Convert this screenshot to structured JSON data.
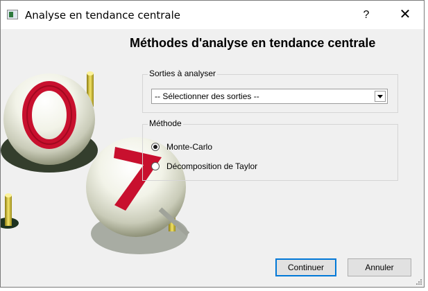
{
  "window": {
    "title": "Analyse en tendance centrale",
    "help_label": "?",
    "close_label": "✕"
  },
  "heading": "Méthodes d'analyse en tendance centrale",
  "outputs": {
    "group_label": "Sorties à analyser",
    "combo_value": "-- Sélectionner des sorties --"
  },
  "method": {
    "group_label": "Méthode",
    "options": [
      {
        "label": "Monte-Carlo",
        "checked": true
      },
      {
        "label": "Décomposition de Taylor",
        "checked": false
      }
    ]
  },
  "buttons": {
    "continue": "Continuer",
    "cancel": "Annuler"
  },
  "colors": {
    "accent": "#0078d7",
    "sphere_text": "#c8102e"
  },
  "icons": {
    "app": "app-window-icon",
    "help": "help-icon",
    "close": "close-icon",
    "dropdown": "chevron-down-icon"
  }
}
